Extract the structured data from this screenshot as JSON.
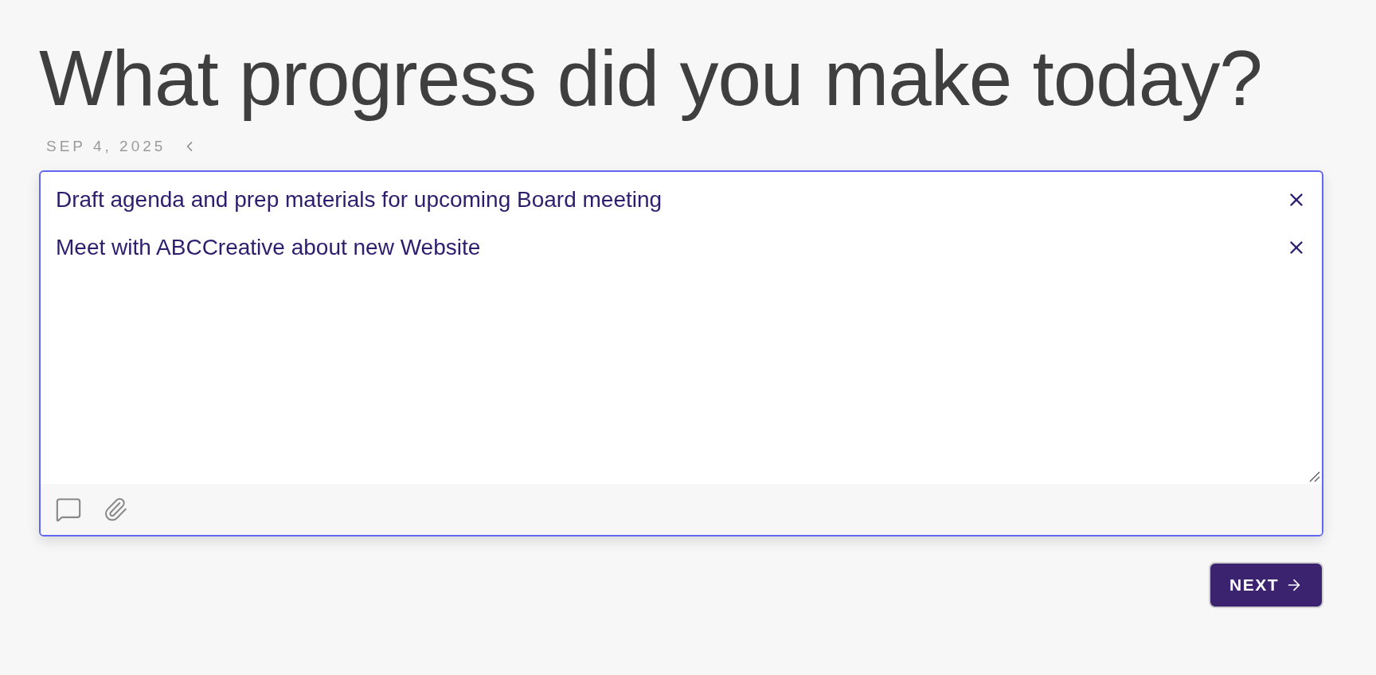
{
  "heading": "What progress did you make today?",
  "date": "SEP 4, 2025",
  "entries": [
    {
      "text": "Draft agenda and prep materials for upcoming Board meeting"
    },
    {
      "text": "Meet with ABCCreative about new Website"
    }
  ],
  "next_button": "NEXT"
}
